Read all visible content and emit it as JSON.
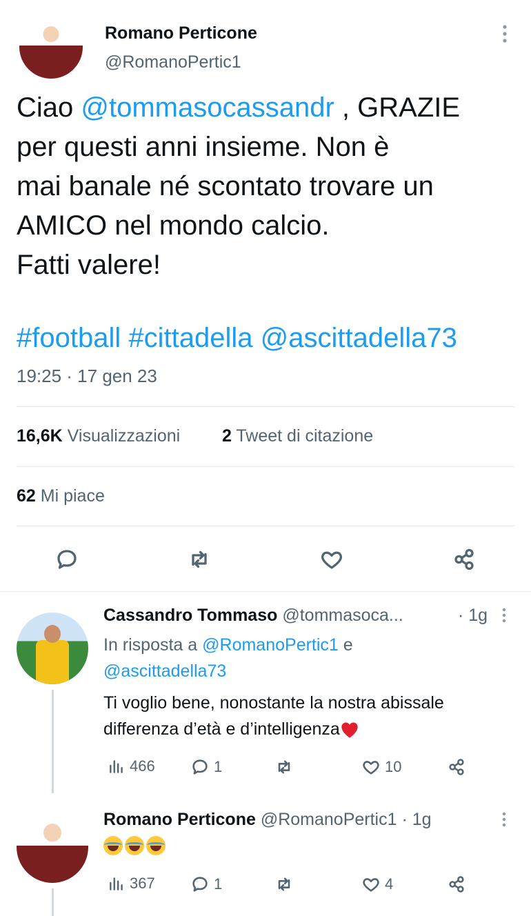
{
  "main_tweet": {
    "author_name": "Romano Perticone",
    "author_handle": "@RomanoPertic1",
    "text_lines": [
      [
        "Ciao ",
        "@tommasocassandr",
        " , GRAZIE"
      ],
      [
        "per questi anni insieme. Non è"
      ],
      [
        "mai banale né scontato trovare un"
      ],
      [
        "AMICO nel mondo calcio."
      ],
      [
        "Fatti valere!"
      ]
    ],
    "text": {
      "l1_pre": "Ciao ",
      "l1_mention": "@tommasocassandr",
      "l1_post": " , GRAZIE",
      "l2": "per questi anni insieme. Non è",
      "l3": "mai banale né scontato trovare un",
      "l4": "AMICO nel mondo calcio.",
      "l5": "Fatti valere!"
    },
    "hashtags": {
      "h1": "#football",
      "h2": "#cittadella",
      "h3": "@ascittadella73"
    },
    "timestamp": "19:25 · 17 gen 23",
    "views_count": "16,6K",
    "views_label": "Visualizzazioni",
    "quotes_count": "2",
    "quotes_label": "Tweet di citazione",
    "likes_count": "62",
    "likes_label": "Mi piace"
  },
  "replies": [
    {
      "name": "Cassandro Tommaso",
      "handle": "@tommasoca...",
      "time": "· 1g",
      "in_reply_prefix": "In risposta a ",
      "in_reply_mention1": "@RomanoPertic1",
      "in_reply_conj": " e",
      "in_reply_mention2": "@ascittadella73",
      "text_l1": "Ti voglio bene, nonostante la nostra abissale",
      "text_l2": "differenza d’età e d’intelligenza",
      "views": "466",
      "replies": "1",
      "retweets": "",
      "likes": "10"
    },
    {
      "name": "Romano Perticone",
      "handle": "@RomanoPertic1",
      "time": "· 1g",
      "views": "367",
      "replies": "1",
      "retweets": "",
      "likes": "4"
    }
  ],
  "icons": {
    "more": "more-vertical-icon",
    "reply": "reply-icon",
    "retweet": "retweet-icon",
    "like": "heart-icon",
    "share": "share-icon",
    "views": "views-icon"
  },
  "colors": {
    "link": "#1d9bf0",
    "muted": "#536471",
    "divider": "#e7ebef"
  }
}
